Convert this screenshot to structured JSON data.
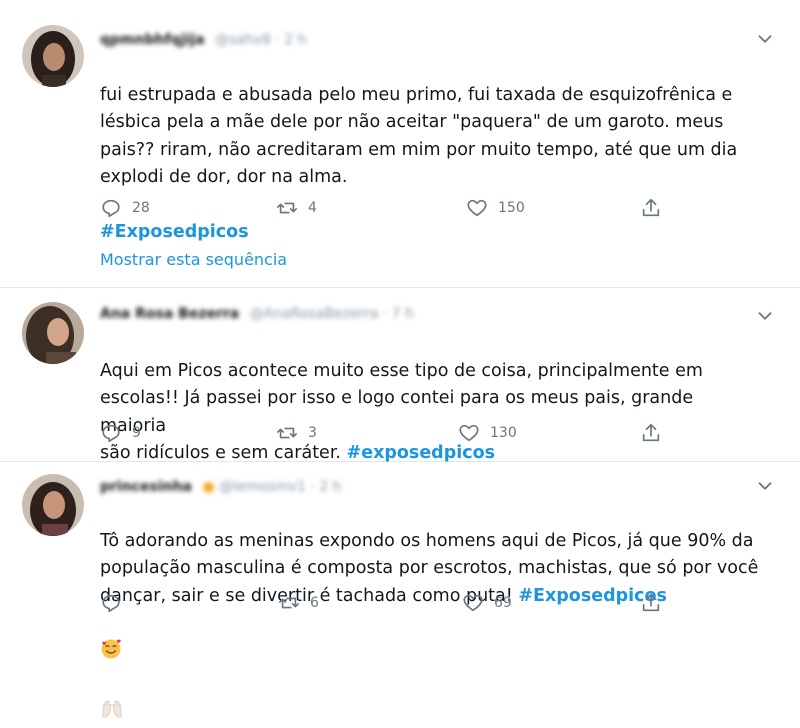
{
  "tweets": [
    {
      "display_name": "qpmnbhfqjija",
      "handle": "@sahv8",
      "time": "· 2 h",
      "text": "fui estrupada e abusada pelo meu primo, fui taxada de  esquizofrênica e\nlésbica pela a mãe dele por não  aceitar \"paquera\" de um garoto. meus\npais?? riram, não  acreditaram em mim por muito tempo, até que um dia\nexplodi de dor, dor na alma.",
      "hashtag": "#Exposedpicos",
      "replies": "28",
      "retweets": "4",
      "likes": "150",
      "show_thread": "Mostrar esta sequência"
    },
    {
      "display_name": "Ana Rosa Bezerra",
      "handle": "@AnaRosaBezerra",
      "time": "· 7 h",
      "text": "Aqui em Picos acontece muito esse tipo de coisa, principalmente em\nescolas!! Já passei por isso e logo contei para os meus pais, grande maioria\nsão ridículos e sem caráter. ",
      "hashtag": "#exposedpicos",
      "replies": "9",
      "retweets": "3",
      "likes": "130"
    },
    {
      "display_name": "princesinha",
      "handle": "@lemosmv1",
      "time": "· 2 h",
      "text": "Tô adorando as meninas expondo os homens aqui de Picos, já que 90% da\npopulação masculina é composta por escrotos, machistas, que só por você\ndançar, sair e se divertir é tachada como puta! ",
      "hashtag": "#Exposedpicos",
      "replies": "",
      "retweets": "6",
      "likes": "69"
    }
  ],
  "icons": {
    "reply": "reply-icon",
    "retweet": "retweet-icon",
    "like": "heart-icon",
    "share": "share-icon",
    "more": "chevron-down-icon"
  },
  "colors": {
    "hashtag": "#1b95e0",
    "action_gray": "#657786",
    "divider": "#e1e8ed"
  }
}
